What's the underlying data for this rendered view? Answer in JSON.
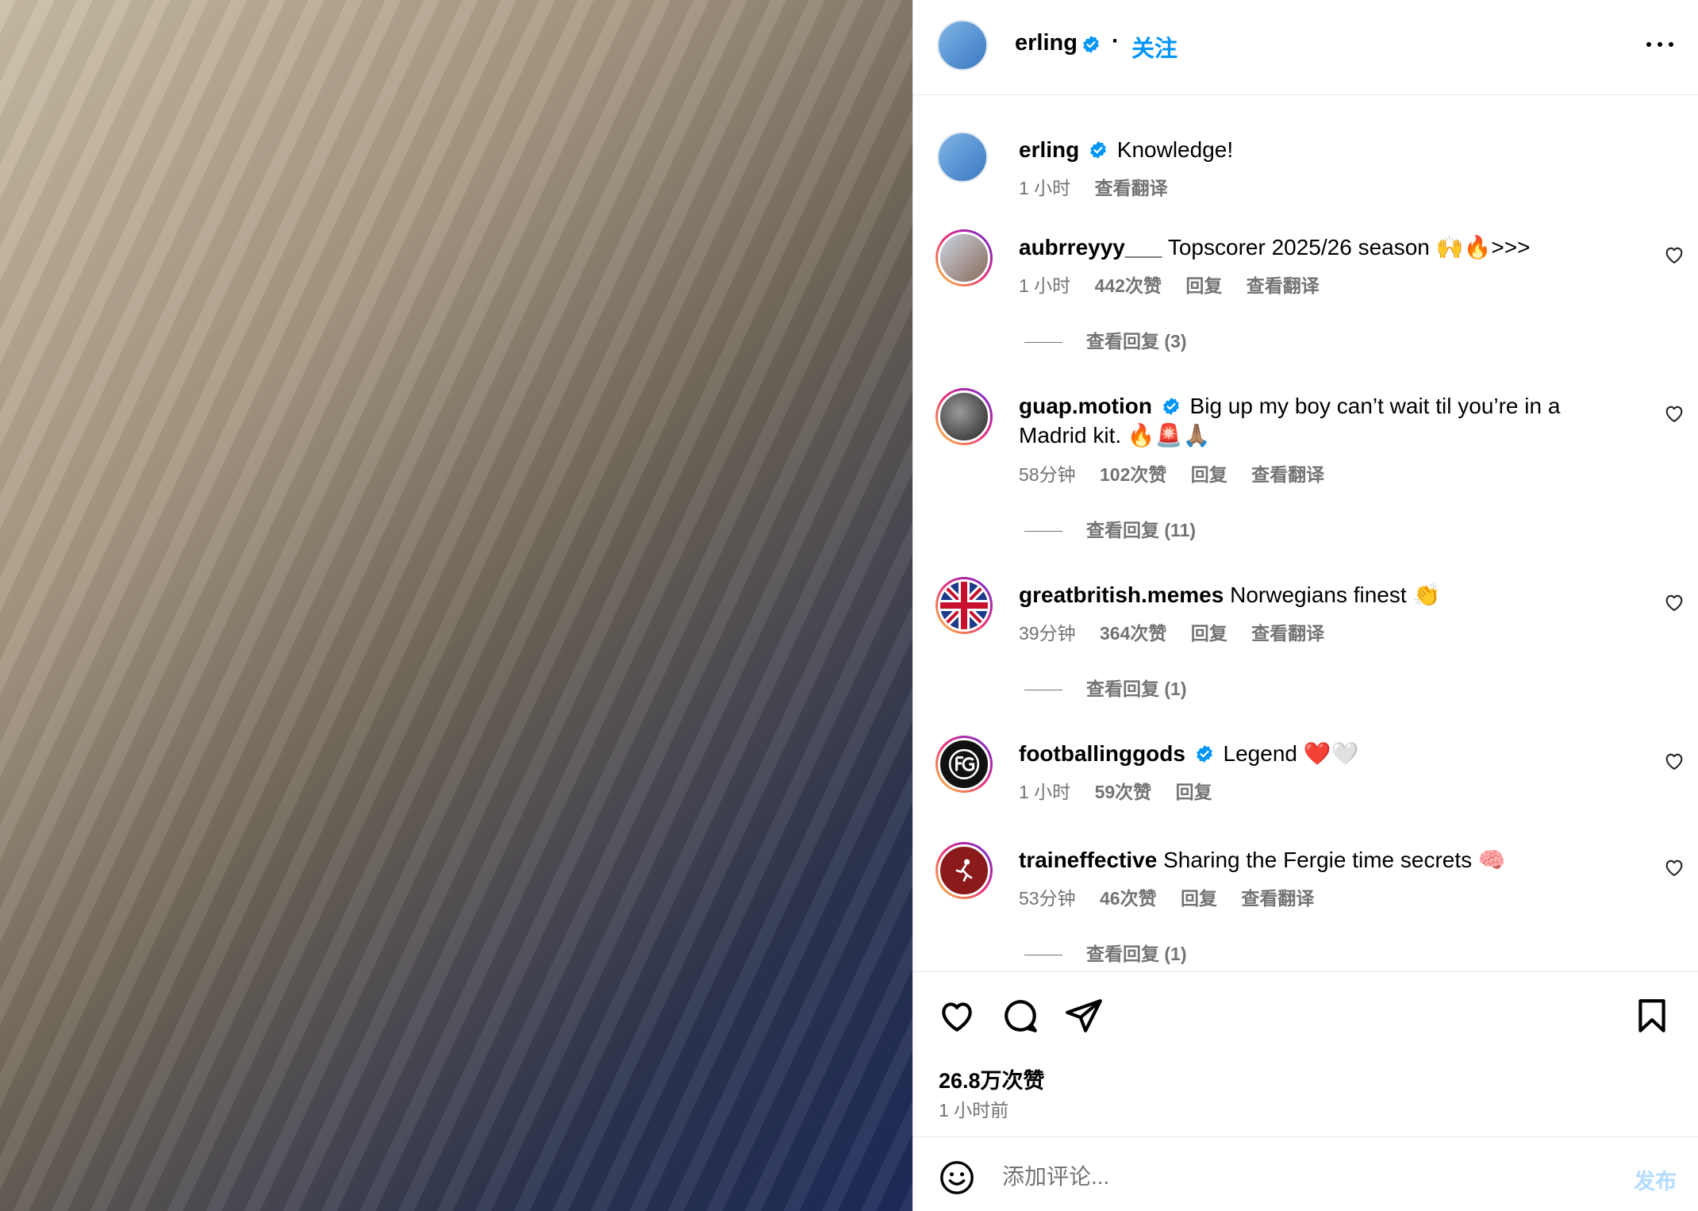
{
  "post": {
    "author": "erling",
    "follow_label": "关注",
    "dot": "·",
    "caption": "Knowledge!",
    "caption_time": "1 小时",
    "see_translation": "查看翻译"
  },
  "comments": [
    {
      "user": "aubrreyyy___",
      "verified": false,
      "text": "Topscorer 2025/26 season 🙌🔥>>>",
      "time": "1 小时",
      "likes": "442次赞",
      "reply": "回复",
      "translate": "查看翻译",
      "view_replies": "查看回复 (3)"
    },
    {
      "user": "guap.motion",
      "verified": true,
      "text": "Big up my boy can’t wait til you’re in a Madrid kit. 🔥🚨🙏🏽",
      "time": "58分钟",
      "likes": "102次赞",
      "reply": "回复",
      "translate": "查看翻译",
      "view_replies": "查看回复 (11)"
    },
    {
      "user": "greatbritish.memes",
      "verified": false,
      "text": "Norwegians finest 👏",
      "time": "39分钟",
      "likes": "364次赞",
      "reply": "回复",
      "translate": "查看翻译",
      "view_replies": "查看回复 (1)"
    },
    {
      "user": "footballinggods",
      "verified": true,
      "text": "Legend ❤️🤍",
      "time": "1 小时",
      "likes": "59次赞",
      "reply": "回复",
      "translate": "",
      "view_replies": ""
    },
    {
      "user": "traineffective",
      "verified": false,
      "text": "Sharing the Fergie time secrets 🧠",
      "time": "53分钟",
      "likes": "46次赞",
      "reply": "回复",
      "translate": "查看翻译",
      "view_replies": "查看回复 (1)"
    }
  ],
  "actions": {
    "likes_count": "26.8万次赞",
    "posted_time": "1 小时前"
  },
  "comment_input": {
    "placeholder": "添加评论...",
    "post_label": "发布"
  },
  "icons": {
    "verified": "verified-badge-icon",
    "more": "more-options-icon",
    "heart": "heart-icon",
    "comment": "comment-icon",
    "share": "share-icon",
    "save": "bookmark-icon",
    "emoji": "emoji-icon"
  },
  "colors": {
    "accent": "#0095f6",
    "muted": "#737373",
    "verified": "#0095f6"
  }
}
